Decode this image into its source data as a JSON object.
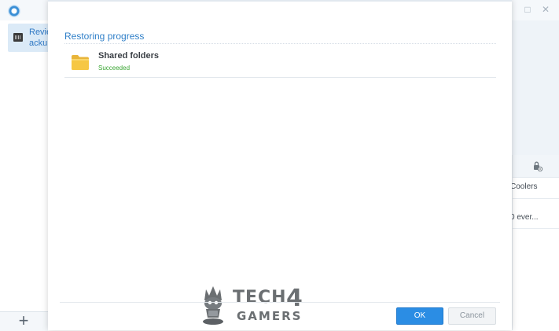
{
  "background_app": {
    "sidebar": {
      "selected_item": {
        "label": "Revie\nackup"
      },
      "add_label": "+"
    },
    "right_panel": {
      "line1": "Coolers",
      "line2": "0 ever..."
    },
    "window_controls": {
      "maximize": "□",
      "close": "✕"
    }
  },
  "dialog": {
    "title": "Restoring progress",
    "tasks": [
      {
        "name": "Shared folders",
        "status": "Succeeded",
        "icon": "folder-icon"
      }
    ],
    "buttons": {
      "ok": "OK",
      "cancel": "Cancel"
    }
  },
  "watermark": {
    "line1": "TECH",
    "numeral": "4",
    "line2": "GAMERS"
  },
  "colors": {
    "accent": "#2f7fc8",
    "ok_button": "#2b8de4",
    "success": "#3aa633",
    "folder": "#f6c744"
  }
}
